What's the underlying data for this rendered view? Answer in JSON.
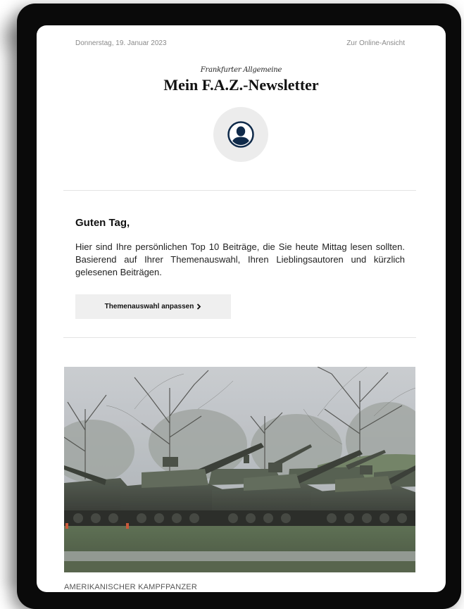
{
  "header": {
    "date": "Donnerstag, 19. Januar 2023",
    "online_view_link": "Zur Online-Ansicht"
  },
  "masthead": {
    "brand": "Frankfurter Allgemeine",
    "title": "Mein F.A.Z.-Newsletter",
    "avatar_icon": "user-avatar-icon"
  },
  "intro": {
    "greeting": "Guten Tag,",
    "text": "Hier sind Ihre persönlichen Top 10 Beiträge, die Sie heute Mittag lesen sollten. Basierend auf Ihrer Themenauswahl, Ihren Lieblingsautoren und kürzlich gelesenen Beiträgen.",
    "cta_label": "Themenauswahl anpassen",
    "cta_icon": "chevron-right-icon"
  },
  "article": {
    "image_subject": "tanks-photo",
    "kicker": "AMERIKANISCHER KAMPFPANZER"
  },
  "colors": {
    "tablet_frame": "#0a0a0a",
    "avatar_bg": "#ececec",
    "avatar_fg": "#0f2a4a",
    "button_bg": "#efefef"
  }
}
